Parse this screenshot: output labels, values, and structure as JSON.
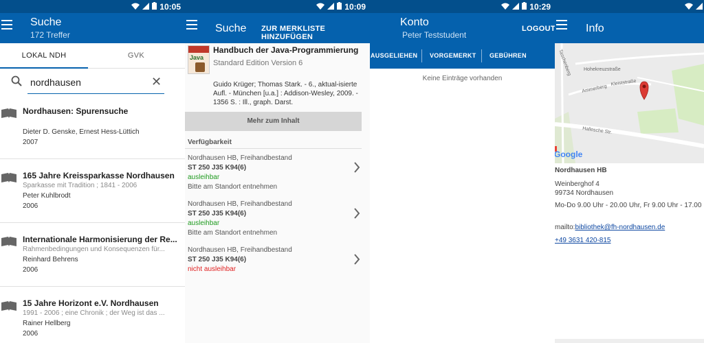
{
  "panel1": {
    "status_time": "10:05",
    "appbar": {
      "title": "Suche",
      "subtitle": "172 Treffer"
    },
    "tabs": [
      "LOKAL NDH",
      "GVK"
    ],
    "search": {
      "value": "nordhausen"
    },
    "results": [
      {
        "title": "Nordhausen: Spurensuche",
        "subtitle": "",
        "author": "Dieter D. Genske, Ernest Hess-Lüttich",
        "year": "2007"
      },
      {
        "title": "165 Jahre Kreissparkasse Nordhausen",
        "subtitle": "Sparkasse mit Tradition ; 1841 - 2006",
        "author": "Peter Kuhlbrodt",
        "year": "2006"
      },
      {
        "title": "Internationale Harmonisierung der Re...",
        "subtitle": "Rahmenbedingungen und Konsequenzen für...",
        "author": "Reinhard Behrens",
        "year": "2006"
      },
      {
        "title": "15 Jahre Horizont e.V. Nordhausen",
        "subtitle": "1991 - 2006 ; eine Chronik ; der Weg ist das ...",
        "author": "Rainer Hellberg",
        "year": "2006"
      }
    ]
  },
  "panel2": {
    "status_time": "10:09",
    "appbar": {
      "title": "Suche",
      "action": "ZUR MERKLISTE HINZUFÜGEN"
    },
    "book": {
      "cover_text": "Java",
      "title": "Handbuch der Java-Programmierung",
      "subtitle": "Standard Edition Version 6",
      "description": "Guido Krüger; Thomas Stark. - 6., aktual-isierte Aufl. - München [u.a.] : Addison-Wesley, 2009. - 1356 S. : Ill., graph. Darst."
    },
    "more_button": "Mehr zum Inhalt",
    "availability_heading": "Verfügbarkeit",
    "holdings": [
      {
        "location": "Nordhausen HB, Freihandbestand",
        "signature": "ST 250 J35 K94(6)",
        "status": "ausleihbar",
        "status_color": "#1e9a1e",
        "note": "Bitte am Standort entnehmen"
      },
      {
        "location": "Nordhausen HB, Freihandbestand",
        "signature": "ST 250 J35 K94(6)",
        "status": "ausleihbar",
        "status_color": "#1e9a1e",
        "note": "Bitte am Standort entnehmen"
      },
      {
        "location": "Nordhausen HB, Freihandbestand",
        "signature": "ST 250 J35 K94(6)",
        "status": "nicht ausleihbar",
        "status_color": "#e02020",
        "note": ""
      }
    ]
  },
  "panel3": {
    "status_time": "10:29",
    "appbar": {
      "title": "Konto",
      "subtitle": "Peter Teststudent",
      "action": "LOGOUT"
    },
    "tabs": [
      "AUSGELIEHEN",
      "VORGEMERKT",
      "GEBÜHREN"
    ],
    "empty_text": "Keine Einträge vorhanden"
  },
  "panel4": {
    "appbar": {
      "title": "Info"
    },
    "map": {
      "streets": [
        "Taschenberg",
        "Hohekreuzstraße",
        "Ammerberg",
        "Kleiststraße",
        "Hallesche Str."
      ],
      "logo": "Google"
    },
    "info": {
      "name": "Nordhausen HB",
      "street": "Weinberghof 4",
      "city": "99734 Nordhausen",
      "hours": "Mo-Do 9.00 Uhr - 20.00 Uhr, Fr 9.00 Uhr - 17.00",
      "mailto_prefix": "mailto:",
      "email": "bibliothek@fh-nordhausen.de",
      "phone": "+49 3631 420-815"
    }
  },
  "colors": {
    "primary": "#0561ad",
    "statusbar": "#034f8c",
    "available": "#1e9a1e",
    "unavailable": "#e02020"
  }
}
